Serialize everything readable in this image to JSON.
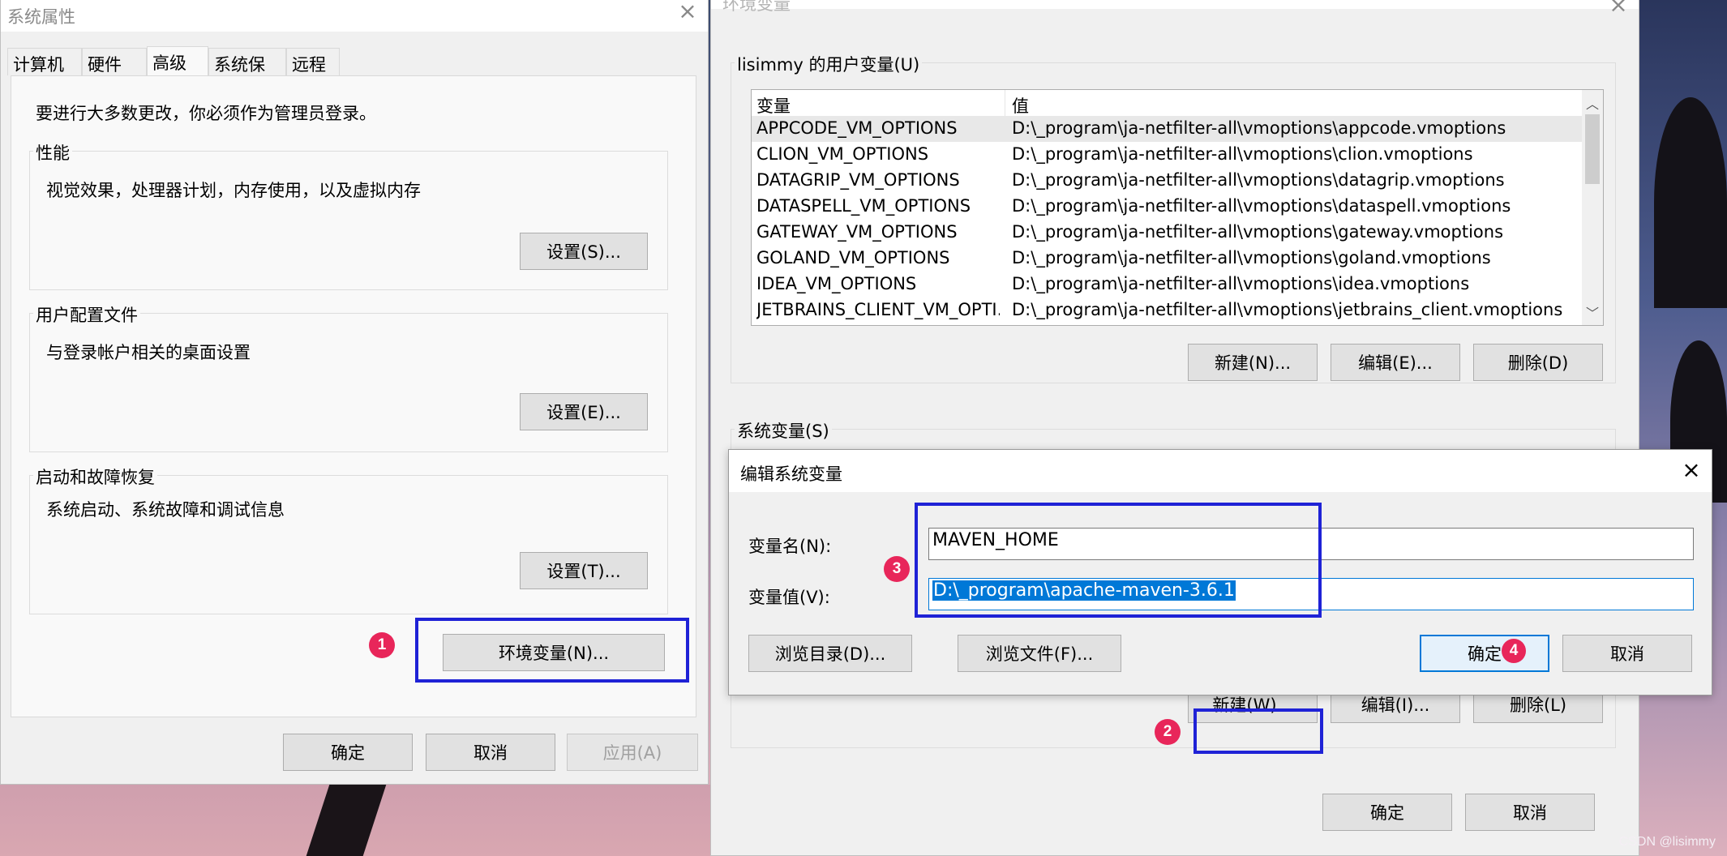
{
  "watermark": "CSDN @lisimmy",
  "sysprops": {
    "title": "系统属性",
    "tabs": [
      "计算机名",
      "硬件",
      "高级",
      "系统保护",
      "远程"
    ],
    "admin_note": "要进行大多数更改，你必须作为管理员登录。",
    "perf_label": "性能",
    "perf_desc": "视觉效果，处理器计划，内存使用，以及虚拟内存",
    "perf_btn": "设置(S)...",
    "profile_label": "用户配置文件",
    "profile_desc": "与登录帐户相关的桌面设置",
    "profile_btn": "设置(E)...",
    "startup_label": "启动和故障恢复",
    "startup_desc": "系统启动、系统故障和调试信息",
    "startup_btn": "设置(T)...",
    "env_btn": "环境变量(N)...",
    "ok": "确定",
    "cancel": "取消",
    "apply": "应用(A)"
  },
  "envvars": {
    "title": "环境变量",
    "user_group": "lisimmy 的用户变量(U)",
    "col_var": "变量",
    "col_val": "值",
    "user_rows": [
      {
        "name": "APPCODE_VM_OPTIONS",
        "value": "D:\\_program\\ja-netfilter-all\\vmoptions\\appcode.vmoptions"
      },
      {
        "name": "CLION_VM_OPTIONS",
        "value": "D:\\_program\\ja-netfilter-all\\vmoptions\\clion.vmoptions"
      },
      {
        "name": "DATAGRIP_VM_OPTIONS",
        "value": "D:\\_program\\ja-netfilter-all\\vmoptions\\datagrip.vmoptions"
      },
      {
        "name": "DATASPELL_VM_OPTIONS",
        "value": "D:\\_program\\ja-netfilter-all\\vmoptions\\dataspell.vmoptions"
      },
      {
        "name": "GATEWAY_VM_OPTIONS",
        "value": "D:\\_program\\ja-netfilter-all\\vmoptions\\gateway.vmoptions"
      },
      {
        "name": "GOLAND_VM_OPTIONS",
        "value": "D:\\_program\\ja-netfilter-all\\vmoptions\\goland.vmoptions"
      },
      {
        "name": "IDEA_VM_OPTIONS",
        "value": "D:\\_program\\ja-netfilter-all\\vmoptions\\idea.vmoptions"
      },
      {
        "name": "JETBRAINS_CLIENT_VM_OPTI...",
        "value": "D:\\_program\\ja-netfilter-all\\vmoptions\\jetbrains_client.vmoptions"
      }
    ],
    "user_new": "新建(N)...",
    "user_edit": "编辑(E)...",
    "user_delete": "删除(D)",
    "sys_group": "系统变量(S)",
    "sys_new": "新建(W)...",
    "sys_edit": "编辑(I)...",
    "sys_delete": "删除(L)",
    "ok": "确定",
    "cancel": "取消"
  },
  "editdlg": {
    "title": "编辑系统变量",
    "name_label": "变量名(N):",
    "name_value": "MAVEN_HOME",
    "value_label": "变量值(V):",
    "value_value": "D:\\_program\\apache-maven-3.6.1",
    "browse_dir": "浏览目录(D)...",
    "browse_file": "浏览文件(F)...",
    "ok": "确定",
    "cancel": "取消"
  },
  "badges": [
    "1",
    "2",
    "3",
    "4"
  ]
}
